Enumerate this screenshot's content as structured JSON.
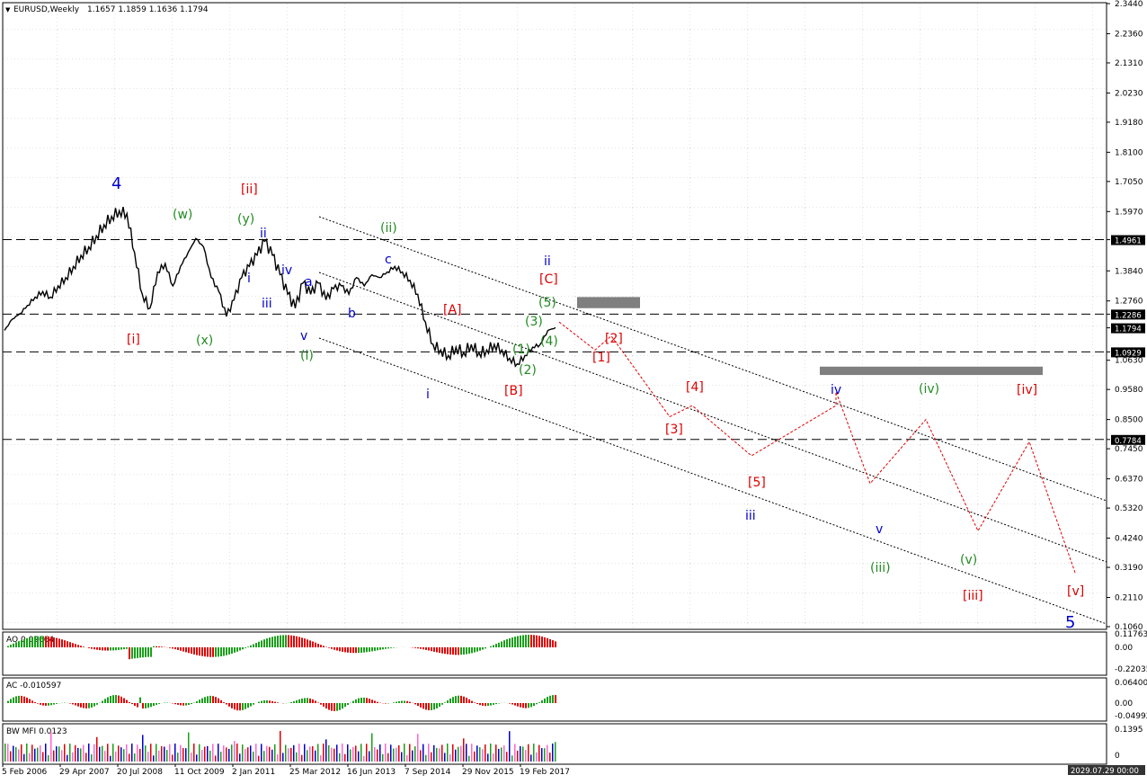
{
  "header": {
    "symbol": "EURUSD,Weekly",
    "ohlc": "1.1657 1.1859 1.1636 1.1794"
  },
  "colors": {
    "blue": "#0000cc",
    "red": "#dd0000",
    "green": "#228b22",
    "grey_zone": "#7f7f7f",
    "osc_green": "#1a9e1a",
    "osc_red": "#e00000"
  },
  "chart_data": [
    {
      "type": "line",
      "panel": "main",
      "title": "EURUSD,Weekly",
      "y_ticks": [
        "2.3440",
        "2.2360",
        "2.1310",
        "2.0230",
        "1.9180",
        "1.8100",
        "1.7050",
        "1.5970",
        "1.4961",
        "1.3840",
        "1.2760",
        "1.2286",
        "1.1794",
        "1.0929",
        "1.0630",
        "0.9580",
        "0.8500",
        "0.7784",
        "0.7450",
        "0.6370",
        "0.5320",
        "0.4240",
        "0.3190",
        "0.2110",
        "0.1060"
      ],
      "ylim": [
        0.106,
        2.344
      ],
      "x_ticks": [
        "5 Feb 2006",
        "29 Apr 2007",
        "20 Jul 2008",
        "11 Oct 2009",
        "2 Jan 2011",
        "25 Mar 2012",
        "16 Jun 2013",
        "7 Sep 2014",
        "29 Nov 2015",
        "19 Feb 2017"
      ],
      "horizontal_levels": [
        1.4961,
        1.2286,
        1.0929,
        0.7784
      ],
      "current_price": 1.1794,
      "series": [
        {
          "values": [
            1.17,
            1.21,
            1.23,
            1.26,
            1.29,
            1.31,
            1.29,
            1.33,
            1.36,
            1.4,
            1.44,
            1.47,
            1.51,
            1.55,
            1.58,
            1.6,
            1.59,
            1.45,
            1.3,
            1.25,
            1.38,
            1.41,
            1.33,
            1.4,
            1.45,
            1.5,
            1.47,
            1.36,
            1.31,
            1.22,
            1.28,
            1.36,
            1.4,
            1.44,
            1.49,
            1.44,
            1.37,
            1.3,
            1.25,
            1.34,
            1.3,
            1.34,
            1.28,
            1.32,
            1.33,
            1.3,
            1.36,
            1.33,
            1.37,
            1.36,
            1.38,
            1.4,
            1.38,
            1.35,
            1.3,
            1.2,
            1.12,
            1.1,
            1.08,
            1.11,
            1.09,
            1.12,
            1.09,
            1.1,
            1.12,
            1.1,
            1.07,
            1.05,
            1.08,
            1.11,
            1.12,
            1.17,
            1.18
          ]
        }
      ],
      "forecast_path": [
        1.2,
        1.1,
        1.15,
        0.86,
        0.9,
        0.72,
        0.9,
        0.95,
        0.62,
        0.85,
        0.45,
        0.77,
        0.3
      ],
      "resistance_zones": [
        {
          "y_low": 1.25,
          "y_high": 1.29
        },
        {
          "y_low": 1.01,
          "y_high": 1.04
        }
      ],
      "annotations": [
        {
          "text": "4",
          "color": "blue"
        },
        {
          "text": "[i]",
          "color": "red"
        },
        {
          "text": "[ii]",
          "color": "red"
        },
        {
          "text": "(w)",
          "color": "green"
        },
        {
          "text": "(x)",
          "color": "green"
        },
        {
          "text": "(y)",
          "color": "green"
        },
        {
          "text": "ii",
          "color": "blue"
        },
        {
          "text": "i",
          "color": "blue"
        },
        {
          "text": "iii",
          "color": "blue"
        },
        {
          "text": "iv",
          "color": "blue"
        },
        {
          "text": "v",
          "color": "blue"
        },
        {
          "text": "a",
          "color": "blue"
        },
        {
          "text": "b",
          "color": "blue"
        },
        {
          "text": "c",
          "color": "blue"
        },
        {
          "text": "(i)",
          "color": "green"
        },
        {
          "text": "(ii)",
          "color": "green"
        },
        {
          "text": "i",
          "color": "blue"
        },
        {
          "text": "[A]",
          "color": "red"
        },
        {
          "text": "[B]",
          "color": "red"
        },
        {
          "text": "[C]",
          "color": "red"
        },
        {
          "text": "ii",
          "color": "blue"
        },
        {
          "text": "(1)",
          "color": "green"
        },
        {
          "text": "(2)",
          "color": "green"
        },
        {
          "text": "(3)",
          "color": "green"
        },
        {
          "text": "(4)",
          "color": "green"
        },
        {
          "text": "(5)",
          "color": "green"
        },
        {
          "text": "[1]",
          "color": "red"
        },
        {
          "text": "[2]",
          "color": "red"
        },
        {
          "text": "[3]",
          "color": "red"
        },
        {
          "text": "[4]",
          "color": "red"
        },
        {
          "text": "[5]",
          "color": "red"
        },
        {
          "text": "iii",
          "color": "blue"
        },
        {
          "text": "iv",
          "color": "blue"
        },
        {
          "text": "v",
          "color": "blue"
        },
        {
          "text": "(iii)",
          "color": "green"
        },
        {
          "text": "(iv)",
          "color": "green"
        },
        {
          "text": "(v)",
          "color": "green"
        },
        {
          "text": "[iii]",
          "color": "red"
        },
        {
          "text": "[iv]",
          "color": "red"
        },
        {
          "text": "[v]",
          "color": "red"
        },
        {
          "text": "5",
          "color": "blue"
        }
      ]
    },
    {
      "type": "bar",
      "panel": "AO",
      "title": "AO 0.02664",
      "y_ticks": [
        "0.11763",
        "0.00",
        "-0.22035"
      ],
      "ylim": [
        -0.22035,
        0.11763
      ]
    },
    {
      "type": "bar",
      "panel": "AC",
      "title": "AC -0.010597",
      "y_ticks": [
        "0.064004",
        "0.00",
        "-0.04992"
      ],
      "ylim": [
        -0.04992,
        0.064004
      ]
    },
    {
      "type": "bar",
      "panel": "BW MFI",
      "title": "BW MFI 0.0123",
      "y_ticks": [
        "0.1395",
        "0"
      ]
    }
  ],
  "footer": {
    "date_box": "2029.07.29 00:00"
  }
}
